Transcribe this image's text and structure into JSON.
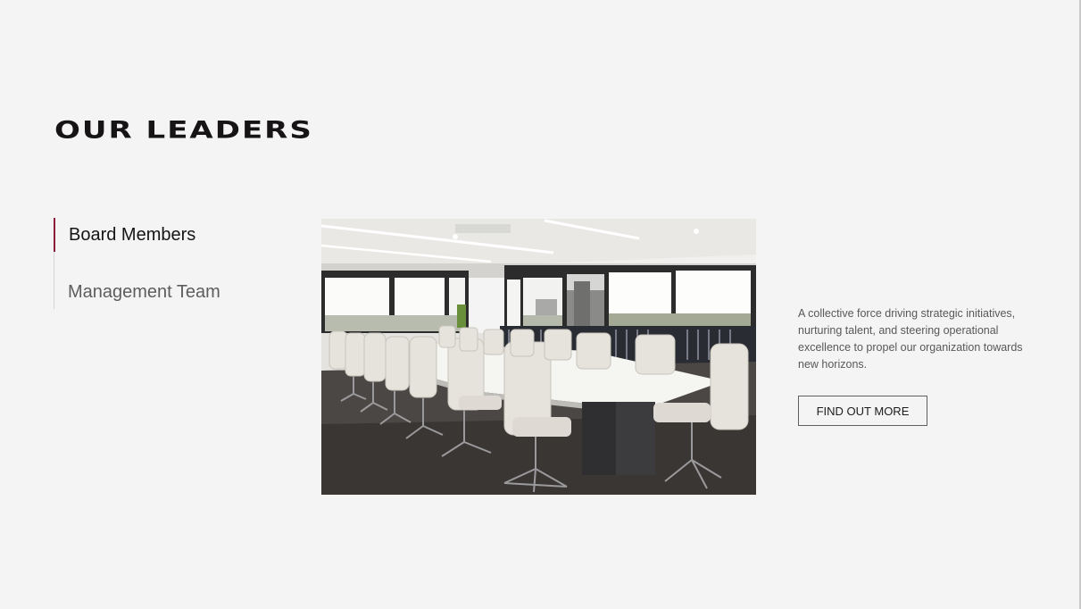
{
  "title": "OUR LEADERS",
  "tabs": [
    {
      "label": "Board Members",
      "active": true
    },
    {
      "label": "Management Team",
      "active": false
    }
  ],
  "description": "A collective force driving strategic initiatives, nurturing talent, and steering operational excellence to propel our organization towards new horizons.",
  "cta_label": "FIND OUT MORE",
  "colors": {
    "background": "#f4f4f4",
    "accent": "#8b1a38",
    "title": "#161414"
  }
}
